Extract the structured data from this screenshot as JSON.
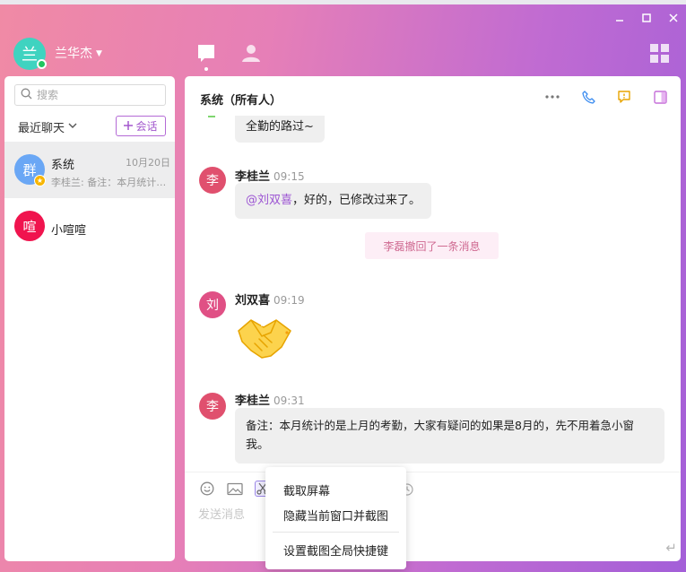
{
  "header": {
    "avatar_char": "兰",
    "user_name": "兰华杰"
  },
  "sidebar": {
    "search_placeholder": "搜索",
    "recent_label": "最近聊天",
    "new_session_label": "会话",
    "conversations": [
      {
        "avatar_char": "群",
        "name": "系统",
        "date": "10月20日",
        "preview": "李桂兰: 备注：本月统计的是上月的考勤，大家有疑问的如果是8月的，先不用着急小窗我。",
        "avatar_color": "#6aa7f5"
      },
      {
        "avatar_char": "喧",
        "name": "小喧喧",
        "avatar_color": "#f0144e"
      }
    ]
  },
  "chat": {
    "title": "系统（所有人）",
    "messages": [
      {
        "text": "全勤的路过~"
      },
      {
        "avatar_char": "李",
        "sender": "李桂兰",
        "time": "09:15",
        "mention": "@刘双喜",
        "text": "，好的，已修改过来了。"
      },
      {
        "system_notice": "李磊撤回了一条消息"
      },
      {
        "avatar_char": "刘",
        "sender": "刘双喜",
        "time": "09:19",
        "emoji": "🤝"
      },
      {
        "avatar_char": "李",
        "sender": "李桂兰",
        "time": "09:31",
        "text_line1": "备注：本月统计的是上月的考勤，大家有疑问的如果是8月的，先不用着急小窗",
        "text_line2": "我。"
      }
    ],
    "composer_placeholder": "发送消息"
  },
  "screenshot_menu": {
    "items": [
      "截取屏幕",
      "隐藏当前窗口并截图",
      "设置截图全局快捷键"
    ]
  },
  "colors": {
    "accent": "#a257cd",
    "mention": "#9c55d3",
    "avatar_li": "#e0506e",
    "avatar_liu": "#e05085"
  }
}
